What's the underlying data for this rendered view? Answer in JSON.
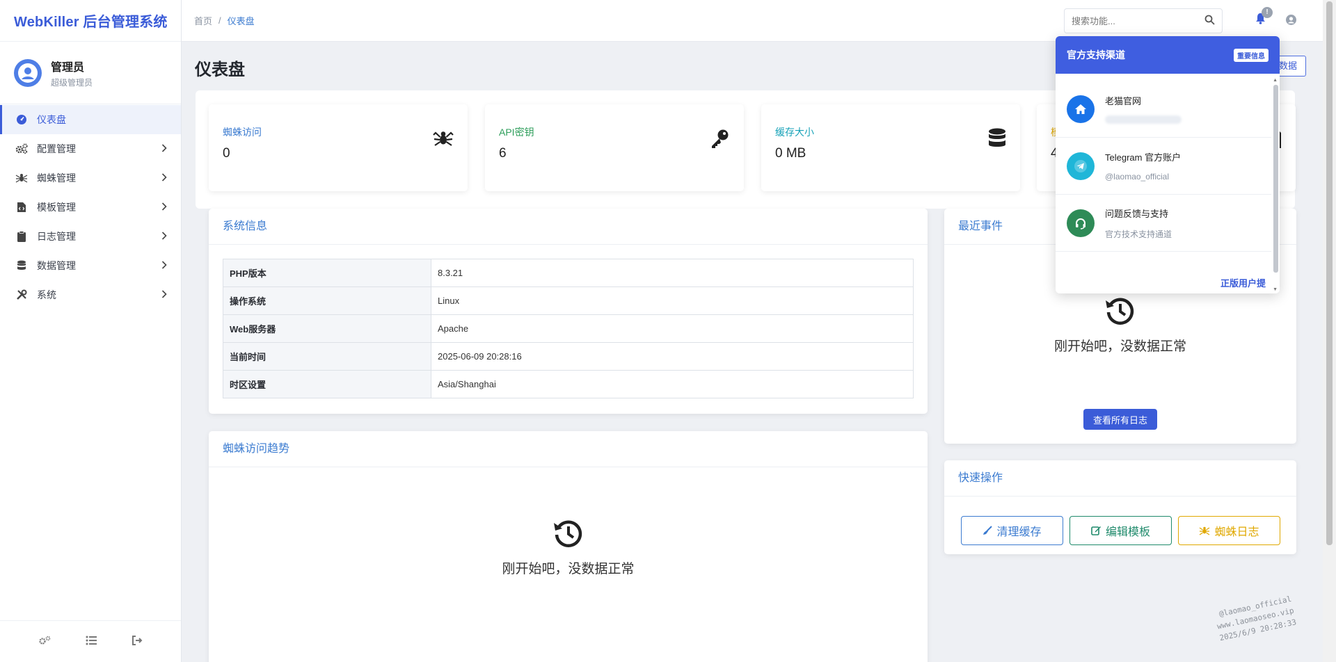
{
  "sidebar": {
    "brand": "WebKiller 后台管理系统",
    "user": {
      "name": "管理员",
      "role": "超级管理员"
    },
    "items": [
      {
        "label": "仪表盘",
        "icon": "gauge-icon",
        "active": true
      },
      {
        "label": "配置管理",
        "icon": "gears-icon"
      },
      {
        "label": "蜘蛛管理",
        "icon": "spider-icon"
      },
      {
        "label": "模板管理",
        "icon": "file-code-icon"
      },
      {
        "label": "日志管理",
        "icon": "clipboard-icon"
      },
      {
        "label": "数据管理",
        "icon": "database-icon"
      },
      {
        "label": "系统",
        "icon": "tools-icon"
      }
    ],
    "footer_icons": [
      "gears-icon",
      "list-icon",
      "logout-icon"
    ]
  },
  "topbar": {
    "breadcrumb": {
      "home": "首页",
      "separator": "/",
      "current": "仪表盘"
    },
    "search_placeholder": "搜索功能...",
    "notification_count": "!"
  },
  "page": {
    "title": "仪表盘",
    "refresh_label": "新数据"
  },
  "stats": [
    {
      "label": "蜘蛛访问",
      "value": "0",
      "color": "#3b7bd0",
      "icon": "spider-icon"
    },
    {
      "label": "API密钥",
      "value": "6",
      "color": "#2e9e5b",
      "icon": "key-icon"
    },
    {
      "label": "缓存大小",
      "value": "0 MB",
      "color": "#17a2b8",
      "icon": "database-icon"
    },
    {
      "label": "模",
      "value": "4",
      "color": "#e0a800",
      "icon": "file-icon"
    }
  ],
  "system_info": {
    "title": "系统信息",
    "rows": [
      {
        "key": "PHP版本",
        "value": "8.3.21"
      },
      {
        "key": "操作系统",
        "value": "Linux"
      },
      {
        "key": "Web服务器",
        "value": "Apache"
      },
      {
        "key": "当前时间",
        "value": "2025-06-09 20:28:16"
      },
      {
        "key": "时区设置",
        "value": "Asia/Shanghai"
      }
    ]
  },
  "spider_trend": {
    "title": "蜘蛛访问趋势",
    "empty_text": "刚开始吧，没数据正常"
  },
  "recent_events": {
    "title": "最近事件",
    "empty_text": "刚开始吧，没数据正常",
    "view_all_label": "查看所有日志"
  },
  "quick_actions": {
    "title": "快速操作",
    "buttons": [
      {
        "label": "清理缓存",
        "color": "#3b7bd0",
        "icon": "broom-icon"
      },
      {
        "label": "编辑模板",
        "color": "#1f8a6b",
        "icon": "edit-icon"
      },
      {
        "label": "蜘蛛日志",
        "color": "#e0a800",
        "icon": "spider-icon"
      }
    ]
  },
  "support_dropdown": {
    "title": "官方支持渠道",
    "badge": "重要信息",
    "items": [
      {
        "name": "老猫官网",
        "sub": "",
        "icon": "home-icon",
        "color": "#1a73e8"
      },
      {
        "name": "Telegram 官方账户",
        "sub": "@laomao_official",
        "icon": "telegram-icon",
        "color": "#1fb6d8"
      },
      {
        "name": "问题反馈与支持",
        "sub": "官方技术支持通道",
        "icon": "headset-icon",
        "color": "#2e8b57"
      }
    ],
    "footer": "正版用户提"
  },
  "watermark": {
    "line1": "@laomao_official",
    "line2": "www.laomaoseo.vip",
    "line3": "2025/6/9 20:28:33"
  }
}
